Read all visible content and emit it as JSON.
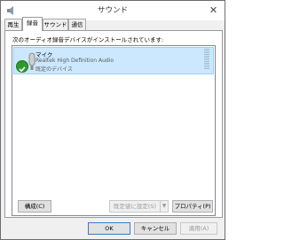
{
  "window": {
    "title": "サウンド"
  },
  "tabs": [
    {
      "label": "再生",
      "active": false
    },
    {
      "label": "録音",
      "active": true
    },
    {
      "label": "サウンド",
      "active": false
    },
    {
      "label": "通信",
      "active": false
    }
  ],
  "recording": {
    "instruction": "次のオーディオ録音デバイスがインストールされています:",
    "devices": [
      {
        "name": "マイク",
        "driver": "Realtek High Definition Audio",
        "status": "既定のデバイス",
        "selected": true,
        "default_icon": "check-icon"
      }
    ]
  },
  "buttons": {
    "configure": "構成(C)",
    "set_default": "既定値に設定(S)",
    "properties": "プロパティ(P)",
    "ok": "OK",
    "cancel": "キャンセル",
    "apply": "適用(A)"
  },
  "colors": {
    "selection": "#cce8ff",
    "default_check": "#2e9a2e"
  }
}
